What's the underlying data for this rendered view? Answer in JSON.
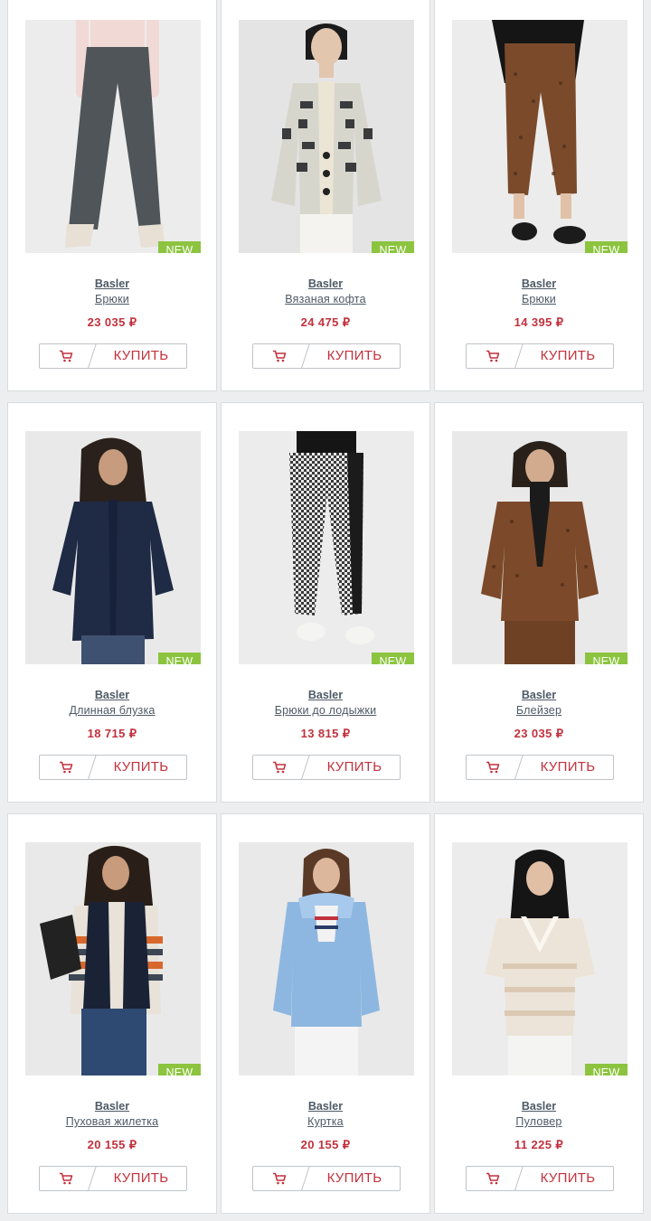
{
  "buy_label": "КУПИТЬ",
  "badge_label": "NEW",
  "colors": {
    "price": "#c2313d",
    "badge": "#8cc43f",
    "link": "#4e5a66"
  },
  "products": [
    {
      "brand": "Basler",
      "name": "Брюки",
      "price": "23 035 ₽",
      "badge": "NEW",
      "image": "model-wide-grey-trousers"
    },
    {
      "brand": "Basler",
      "name": "Вязаная кофта",
      "price": "24 475 ₽",
      "badge": "NEW",
      "image": "model-patterned-knit-cardigan"
    },
    {
      "brand": "Basler",
      "name": "Брюки",
      "price": "14 395 ₽",
      "badge": "NEW",
      "image": "model-brown-print-trousers"
    },
    {
      "brand": "Basler",
      "name": "Длинная блузка",
      "price": "18 715 ₽",
      "badge": "NEW",
      "image": "model-navy-long-blouse"
    },
    {
      "brand": "Basler",
      "name": "Брюки до лодыжки",
      "price": "13 815 ₽",
      "badge": "NEW",
      "image": "model-houndstooth-ankle-trousers"
    },
    {
      "brand": "Basler",
      "name": "Блейзер",
      "price": "23 035 ₽",
      "badge": "NEW",
      "image": "model-brown-print-blazer"
    },
    {
      "brand": "Basler",
      "name": "Пуховая жилетка",
      "price": "20 155 ₽",
      "badge": "NEW",
      "image": "model-navy-down-vest"
    },
    {
      "brand": "Basler",
      "name": "Куртка",
      "price": "20 155 ₽",
      "badge": "",
      "image": "model-light-blue-jacket"
    },
    {
      "brand": "Basler",
      "name": "Пуловер",
      "price": "11 225 ₽",
      "badge": "NEW",
      "image": "model-cream-knit-pullover"
    }
  ]
}
